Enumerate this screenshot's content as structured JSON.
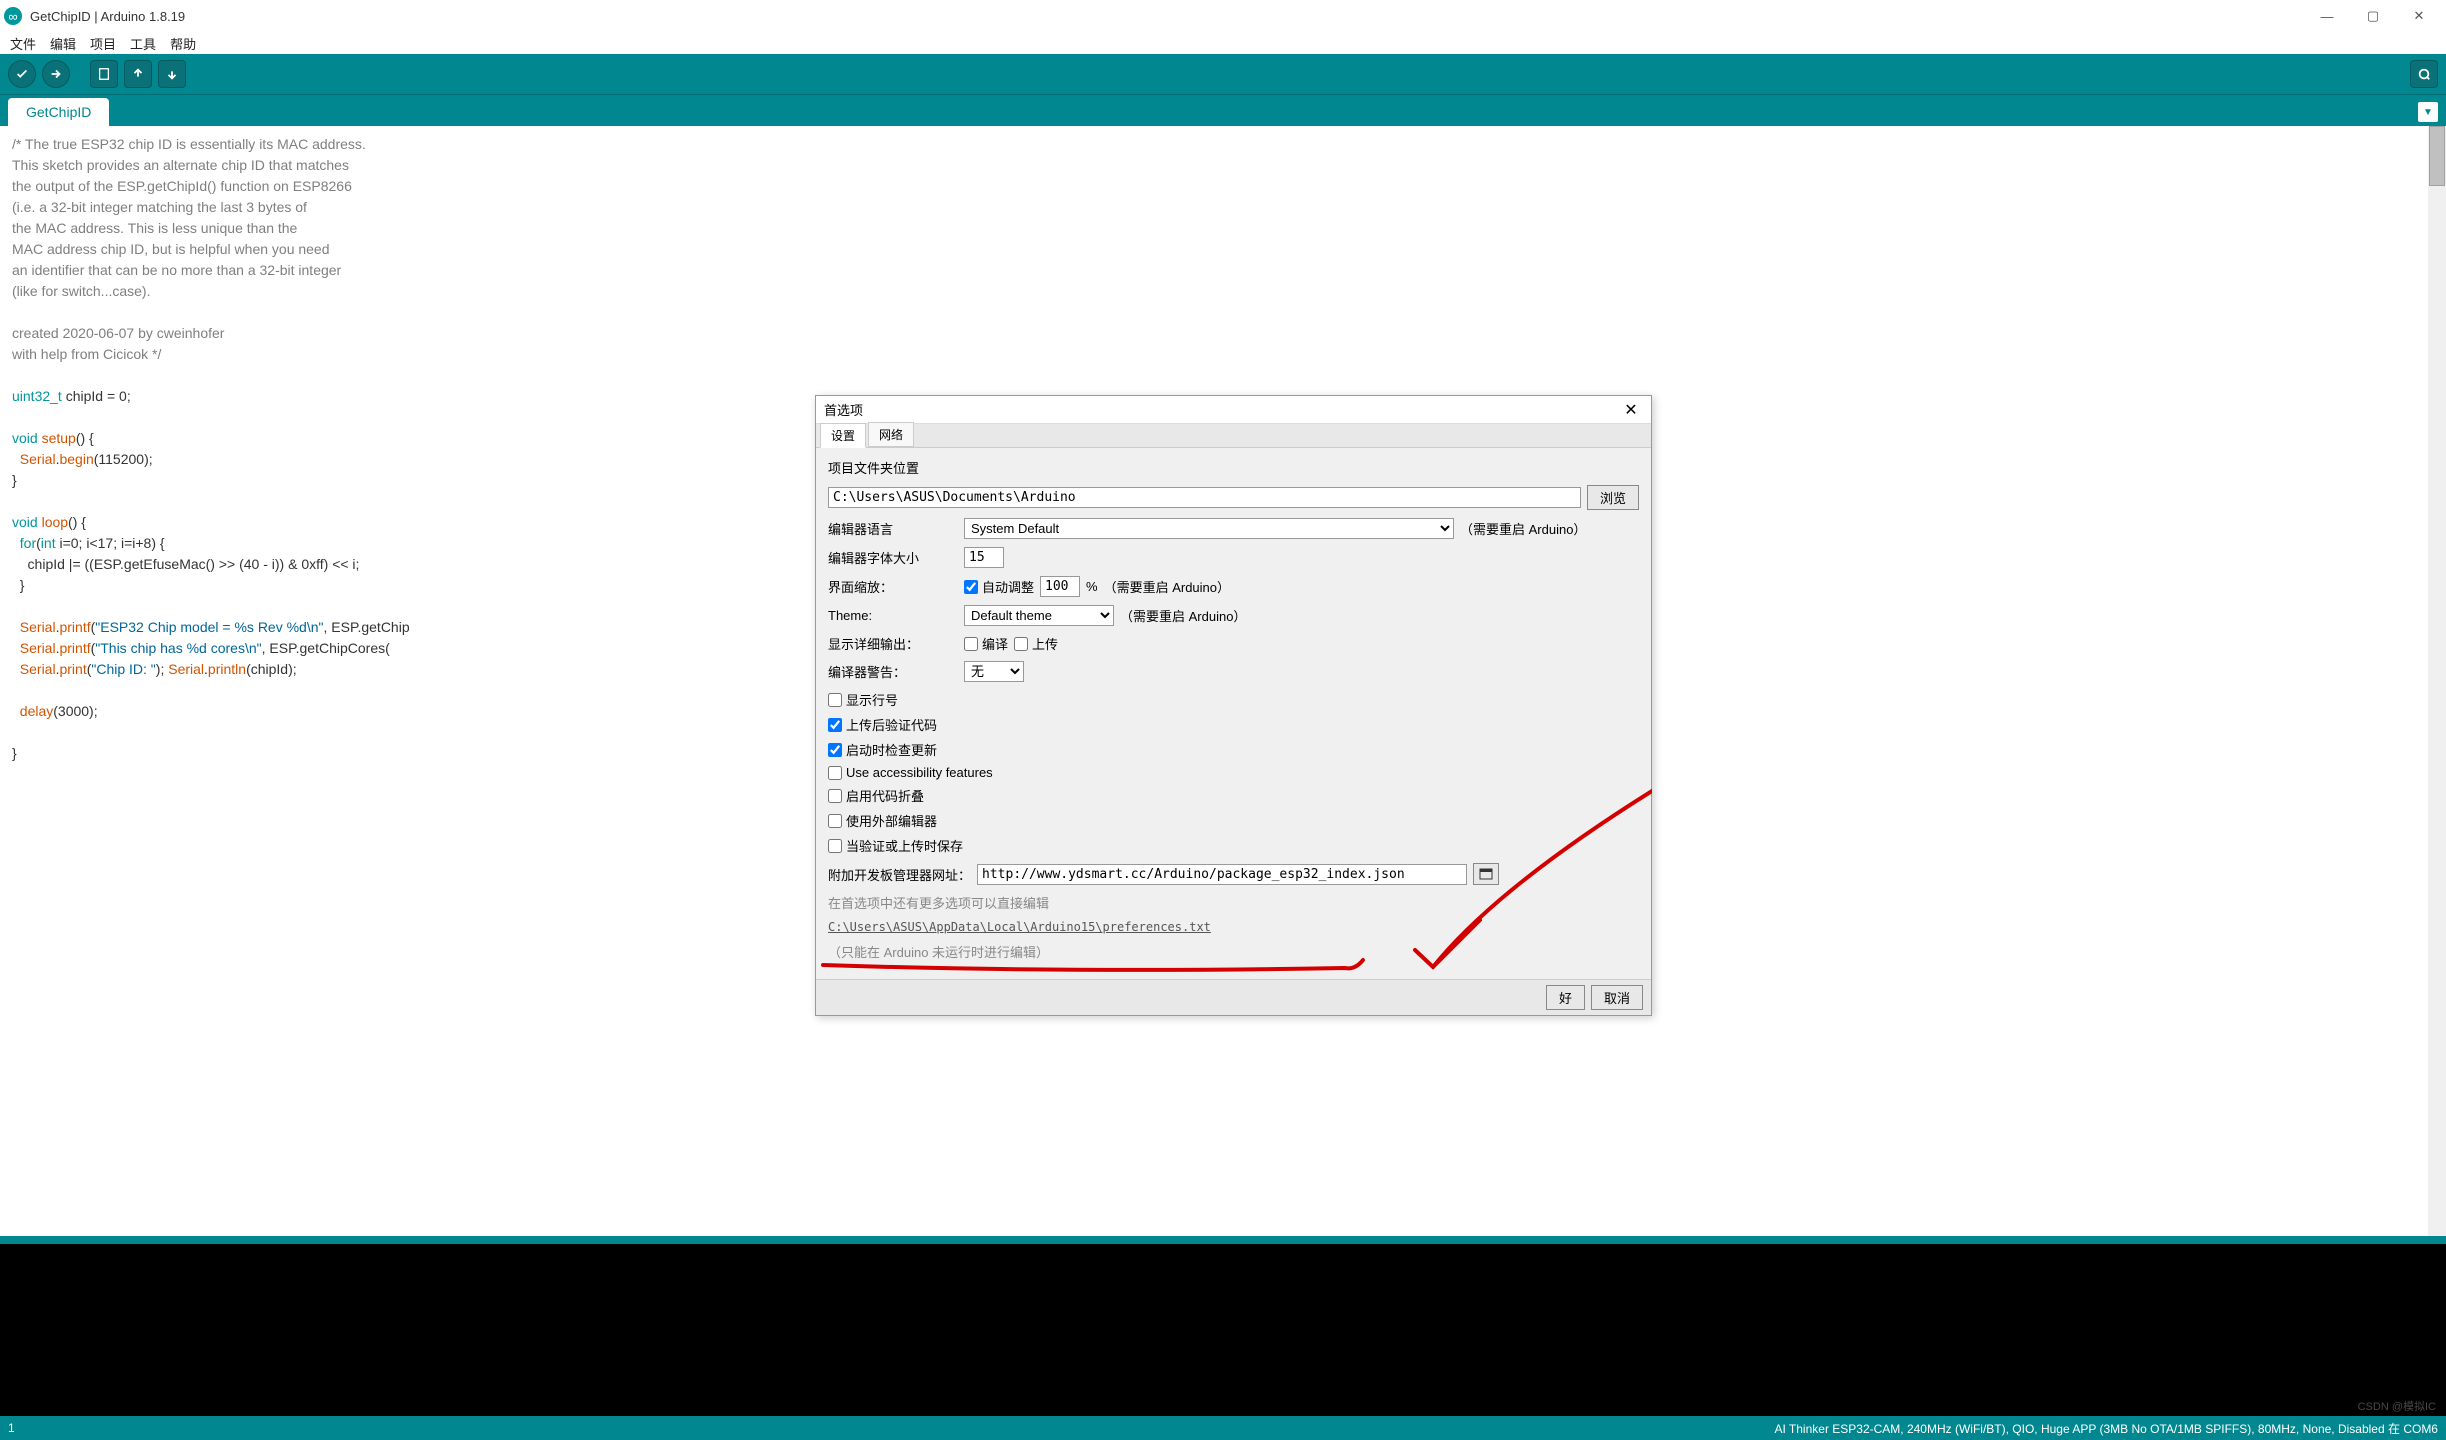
{
  "titlebar": {
    "title": "GetChipID | Arduino 1.8.19"
  },
  "menu": {
    "file": "文件",
    "edit": "编辑",
    "project": "项目",
    "tools": "工具",
    "help": "帮助"
  },
  "tabs": {
    "active": "GetChipID"
  },
  "code": {
    "lines": [
      {
        "t": "cmt",
        "v": "/* The true ESP32 chip ID is essentially its MAC address."
      },
      {
        "t": "cmt",
        "v": "This sketch provides an alternate chip ID that matches"
      },
      {
        "t": "cmt",
        "v": "the output of the ESP.getChipId() function on ESP8266"
      },
      {
        "t": "cmt",
        "v": "(i.e. a 32-bit integer matching the last 3 bytes of"
      },
      {
        "t": "cmt",
        "v": "the MAC address. This is less unique than the"
      },
      {
        "t": "cmt",
        "v": "MAC address chip ID, but is helpful when you need"
      },
      {
        "t": "cmt",
        "v": "an identifier that can be no more than a 32-bit integer"
      },
      {
        "t": "cmt",
        "v": "(like for switch...case)."
      },
      {
        "t": "",
        "v": ""
      },
      {
        "t": "cmt",
        "v": "created 2020-06-07 by cweinhofer"
      },
      {
        "t": "cmt",
        "v": "with help from Cicicok */"
      },
      {
        "t": "",
        "v": ""
      },
      {
        "t": "raw",
        "v": "<span class='type'>uint32_t</span> chipId = 0;"
      },
      {
        "t": "",
        "v": ""
      },
      {
        "t": "raw",
        "v": "<span class='kw'>void</span> <span class='fn'>setup</span>() {"
      },
      {
        "t": "raw",
        "v": "  <span class='fn'>Serial</span>.<span class='fn'>begin</span>(115200);"
      },
      {
        "t": "",
        "v": "}"
      },
      {
        "t": "",
        "v": ""
      },
      {
        "t": "raw",
        "v": "<span class='kw'>void</span> <span class='fn'>loop</span>() {"
      },
      {
        "t": "raw",
        "v": "  <span class='kw'>for</span>(<span class='kw'>int</span> i=0; i&lt;17; i=i+8) {"
      },
      {
        "t": "raw",
        "v": "    chipId |= ((ESP.getEfuseMac() &gt;&gt; (40 - i)) &amp; 0xff) &lt;&lt; i;"
      },
      {
        "t": "",
        "v": "  }"
      },
      {
        "t": "",
        "v": ""
      },
      {
        "t": "raw",
        "v": "  <span class='fn'>Serial</span>.<span class='fn'>printf</span>(<span class='str'>\"ESP32 Chip model = %s Rev %d\\n\"</span>, ESP.getChip"
      },
      {
        "t": "raw",
        "v": "  <span class='fn'>Serial</span>.<span class='fn'>printf</span>(<span class='str'>\"This chip has %d cores\\n\"</span>, ESP.getChipCores("
      },
      {
        "t": "raw",
        "v": "  <span class='fn'>Serial</span>.<span class='fn'>print</span>(<span class='str'>\"Chip ID: \"</span>); <span class='fn'>Serial</span>.<span class='fn'>println</span>(chipId);"
      },
      {
        "t": "",
        "v": ""
      },
      {
        "t": "raw",
        "v": "  <span class='fn'>delay</span>(3000);"
      },
      {
        "t": "",
        "v": ""
      },
      {
        "t": "",
        "v": "}"
      }
    ]
  },
  "dialog": {
    "title": "首选项",
    "tab_settings": "设置",
    "tab_network": "网络",
    "sketch_loc_label": "项目文件夹位置",
    "sketch_loc": "C:\\Users\\ASUS\\Documents\\Arduino",
    "browse": "浏览",
    "lang_label": "编辑器语言",
    "lang_value": "System Default",
    "lang_hint": "（需要重启 Arduino）",
    "font_label": "编辑器字体大小",
    "font_value": "15",
    "scale_label": "界面缩放：",
    "scale_auto": "自动调整",
    "scale_value": "100",
    "scale_pct": "%",
    "scale_hint": "（需要重启 Arduino）",
    "theme_label": "Theme:",
    "theme_value": "Default theme",
    "theme_hint": "（需要重启 Arduino）",
    "verbose_label": "显示详细输出：",
    "verbose_compile": "编译",
    "verbose_upload": "上传",
    "warn_label": "编译器警告：",
    "warn_value": "无",
    "cb_line_numbers": "显示行号",
    "cb_code_folding": "启用代码折叠",
    "cb_verify_upload": "上传后验证代码",
    "cb_external_editor": "使用外部编辑器",
    "cb_check_update": "启动时检查更新",
    "cb_save_verify": "当验证或上传时保存",
    "cb_accessibility": "Use accessibility features",
    "boards_url_label": "附加开发板管理器网址：",
    "boards_url": "http://www.ydsmart.cc/Arduino/package_esp32_index.json",
    "more_prefs_hint": "在首选项中还有更多选项可以直接编辑",
    "prefs_path": "C:\\Users\\ASUS\\AppData\\Local\\Arduino15\\preferences.txt",
    "edit_hint": "（只能在 Arduino 未运行时进行编辑）",
    "ok": "好",
    "cancel": "取消"
  },
  "status": {
    "left": "1",
    "right": "AI Thinker ESP32-CAM, 240MHz (WiFi/BT), QIO, Huge APP (3MB No OTA/1MB SPIFFS), 80MHz, None, Disabled 在 COM6"
  },
  "watermark": "CSDN @模拟IC"
}
